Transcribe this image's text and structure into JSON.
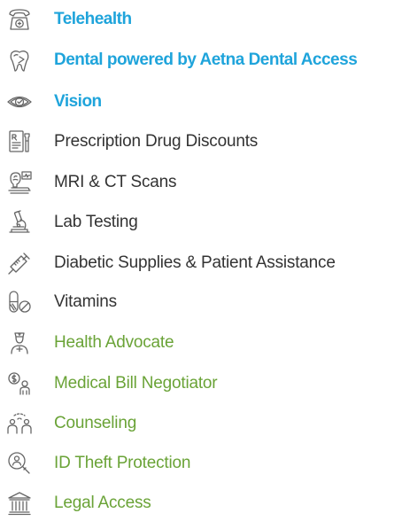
{
  "colors": {
    "blue": "#1fa4db",
    "dark": "#333333",
    "green": "#6aa337",
    "icon": "#666666"
  },
  "items": [
    {
      "label": "Telehealth",
      "icon": "telephone-medical-icon",
      "tone": "blue",
      "weight": "bold"
    },
    {
      "label": "Dental powered by Aetna Dental Access",
      "icon": "tooth-icon",
      "tone": "blue",
      "weight": "bold"
    },
    {
      "label": "Vision",
      "icon": "eye-icon",
      "tone": "blue",
      "weight": "bold"
    },
    {
      "label": "Prescription Drug Discounts",
      "icon": "prescription-icon",
      "tone": "dark",
      "weight": "normal"
    },
    {
      "label": "MRI & CT Scans",
      "icon": "mri-scan-icon",
      "tone": "dark",
      "weight": "normal"
    },
    {
      "label": "Lab Testing",
      "icon": "microscope-icon",
      "tone": "dark",
      "weight": "normal"
    },
    {
      "label": "Diabetic Supplies & Patient Assistance",
      "icon": "syringe-icon",
      "tone": "dark",
      "weight": "normal"
    },
    {
      "label": "Vitamins",
      "icon": "pills-icon",
      "tone": "dark",
      "weight": "normal"
    },
    {
      "label": "Health Advocate",
      "icon": "nurse-icon",
      "tone": "green",
      "weight": "normal"
    },
    {
      "label": "Medical Bill Negotiator",
      "icon": "bill-negotiator-icon",
      "tone": "green",
      "weight": "normal"
    },
    {
      "label": "Counseling",
      "icon": "counseling-icon",
      "tone": "green",
      "weight": "normal"
    },
    {
      "label": "ID Theft Protection",
      "icon": "magnifier-person-icon",
      "tone": "green",
      "weight": "normal"
    },
    {
      "label": "Legal Access",
      "icon": "courthouse-icon",
      "tone": "green",
      "weight": "normal"
    }
  ]
}
